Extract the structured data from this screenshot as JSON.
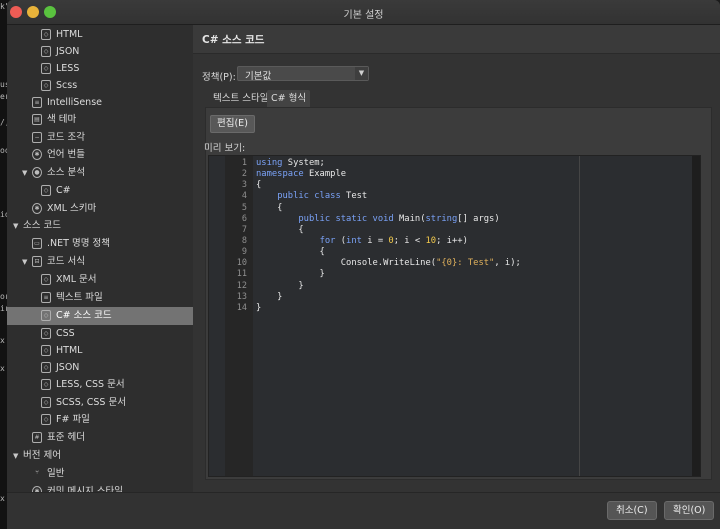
{
  "window": {
    "title": "기본 설정"
  },
  "sidebar": {
    "items": [
      {
        "label": "HTML",
        "icon": "document-code-icon"
      },
      {
        "label": "JSON",
        "icon": "document-code-icon"
      },
      {
        "label": "LESS",
        "icon": "document-code-icon"
      },
      {
        "label": "Scss",
        "icon": "document-code-icon"
      },
      {
        "label": "IntelliSense",
        "icon": "intellisense-icon"
      },
      {
        "label": "색 테마",
        "icon": "color-theme-icon"
      },
      {
        "label": "코드 조각",
        "icon": "snippet-icon"
      },
      {
        "label": "언어 번들",
        "icon": "gear-icon"
      },
      {
        "label": "소스 분석",
        "icon": "analysis-icon",
        "arrow": "▼"
      },
      {
        "label": "C#",
        "icon": "document-code-icon"
      },
      {
        "label": "XML 스키마",
        "icon": "gear-icon"
      },
      {
        "label": "소스 코드",
        "arrow": "▼"
      },
      {
        "label": ".NET 명명 정책",
        "icon": "naming-icon"
      },
      {
        "label": "코드 서식",
        "icon": "code-format-icon",
        "arrow": "▼"
      },
      {
        "label": "XML 문서",
        "icon": "document-code-icon"
      },
      {
        "label": "텍스트 파일",
        "icon": "text-file-icon"
      },
      {
        "label": "C# 소스 코드",
        "icon": "document-code-icon",
        "selected": true
      },
      {
        "label": "CSS",
        "icon": "document-code-icon"
      },
      {
        "label": "HTML",
        "icon": "document-code-icon"
      },
      {
        "label": "JSON",
        "icon": "document-code-icon"
      },
      {
        "label": "LESS, CSS 문서",
        "icon": "document-code-icon"
      },
      {
        "label": "SCSS, CSS 문서",
        "icon": "document-code-icon"
      },
      {
        "label": "F# 파일",
        "icon": "document-code-icon"
      },
      {
        "label": "표준 헤더",
        "icon": "header-icon"
      },
      {
        "label": "버전 제어",
        "arrow": "▼"
      },
      {
        "label": "일반",
        "icon": "branch-icon"
      },
      {
        "label": "커밋 메시지 스타일",
        "icon": "gear-icon"
      }
    ]
  },
  "header": {
    "title": "C# 소스 코드"
  },
  "policy": {
    "label": "정책(P):",
    "value": "기본값"
  },
  "tabs": [
    {
      "label": "텍스트 스타일"
    },
    {
      "label": "C# 형식",
      "active": true
    }
  ],
  "edit_button": "편집(E)",
  "preview_label": "미리 보기:",
  "code": {
    "line_numbers": [
      "1",
      "2",
      "3",
      "4",
      "5",
      "6",
      "7",
      "8",
      "9",
      "10",
      "11",
      "12",
      "13",
      "14"
    ],
    "lines": [
      [
        [
          "kw",
          "using"
        ],
        [
          "t",
          " System;"
        ]
      ],
      [
        [
          "kw",
          "namespace"
        ],
        [
          "t",
          " Example"
        ]
      ],
      [
        [
          "t",
          "{"
        ]
      ],
      [
        [
          "t",
          "    "
        ],
        [
          "kw",
          "public class"
        ],
        [
          "t",
          " Test"
        ]
      ],
      [
        [
          "t",
          "    {"
        ]
      ],
      [
        [
          "t",
          "        "
        ],
        [
          "kw",
          "public static void"
        ],
        [
          "t",
          " Main("
        ],
        [
          "kw",
          "string"
        ],
        [
          "t",
          "[] args)"
        ]
      ],
      [
        [
          "t",
          "        {"
        ]
      ],
      [
        [
          "t",
          "            "
        ],
        [
          "kw",
          "for"
        ],
        [
          "t",
          " ("
        ],
        [
          "kw",
          "int"
        ],
        [
          "t",
          " i = "
        ],
        [
          "num",
          "0"
        ],
        [
          "t",
          "; i < "
        ],
        [
          "num",
          "10"
        ],
        [
          "t",
          "; i++)"
        ]
      ],
      [
        [
          "t",
          "            {"
        ]
      ],
      [
        [
          "t",
          "                Console.WriteLine("
        ],
        [
          "str",
          "\"{0}: Test\""
        ],
        [
          "t",
          ", i);"
        ]
      ],
      [
        [
          "t",
          "            }"
        ]
      ],
      [
        [
          "t",
          "        }"
        ]
      ],
      [
        [
          "t",
          "    }"
        ]
      ],
      [
        [
          "t",
          "}"
        ]
      ]
    ]
  },
  "footer": {
    "cancel": "취소(C)",
    "ok": "확인(O)"
  },
  "background_strip": {
    "fragments": [
      "k\")",
      "us",
      "er",
      "/,",
      "oo",
      "ion",
      "or",
      "ir",
      "x",
      "x",
      "x"
    ]
  }
}
